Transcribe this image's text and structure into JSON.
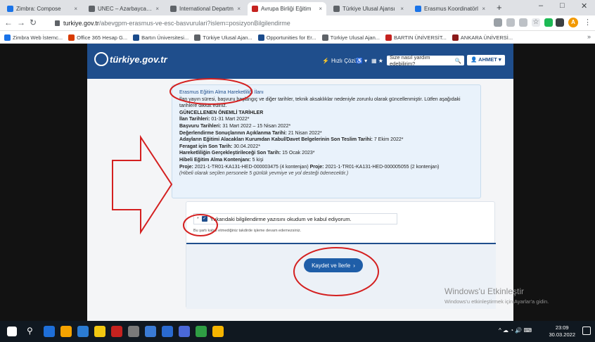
{
  "browser": {
    "tabs": [
      {
        "label": "Zimbra: Compose",
        "color": "#1a73e8"
      },
      {
        "label": "UNEC – Azarbaycan D",
        "color": "#5f6368"
      },
      {
        "label": "International Departm",
        "color": "#5f6368"
      },
      {
        "label": "Avrupa Birliği Eğitim",
        "color": "#c5221f",
        "active": true
      },
      {
        "label": "Türkiye Ulusal Ajansı",
        "color": "#5f6368"
      },
      {
        "label": "Erasmus Koordinatörl",
        "color": "#1a73e8"
      }
    ],
    "url_host": "turkiye.gov.tr",
    "url_path": "/abevgpm-erasmus-ve-esc-basvurulari?islem=posizyonBilgilendirme",
    "profile_initial": "A",
    "bookmarks": [
      {
        "label": "Zimbra Web İstemc...",
        "color": "#1a73e8"
      },
      {
        "label": "Office 365 Hesap G...",
        "color": "#d83b01"
      },
      {
        "label": "Bartın Üniversitesi...",
        "color": "#1a4b8c"
      },
      {
        "label": "Türkiye Ulusal Ajan...",
        "color": "#5f6368"
      },
      {
        "label": "Opportunities for Er...",
        "color": "#1a4b8c"
      },
      {
        "label": "Türkiye Ulusal Ajan...",
        "color": "#5f6368"
      },
      {
        "label": "BARTIN ÜNİVERSİT...",
        "color": "#c5221f"
      },
      {
        "label": "ANKARA ÜNİVERSİ...",
        "color": "#8b1a1a"
      }
    ]
  },
  "site": {
    "logo_text": "türkiye.gov.tr",
    "quick_ops": "Hızlı Çözüm",
    "search_placeholder": "Size nasıl yardım edebilirim?",
    "user_label": "AHMET"
  },
  "info_box": {
    "link_title": "Erasmus Eğitim Alma Hareketliliği İlanı",
    "intro": "İlan yayın süresi, başvuru başlangıç ve diğer tarihler, teknik aksaklıklar nedeniyle zorunlu olarak güncellenmiştir. Lütfen aşağıdaki tarihlere dikkat ediniz.",
    "updated_heading": "GÜNCELLENEN ÖNEMLİ TARİHLER",
    "lines": [
      {
        "label": "İlan Tarihleri:",
        "value": "01-31 Mart 2022*"
      },
      {
        "label": "Başvuru Tarihleri:",
        "value": "31 Mart 2022 – 15 Nisan 2022*"
      },
      {
        "label": "Değerlendirme Sonuçlarının Açıklanma Tarihi:",
        "value": "21 Nisan 2022*"
      },
      {
        "label": "Adayların Eğitimi Alacakları Kurumdan Kabul/Davet Belgelerinin Son Teslim Tarihi:",
        "value": "7 Ekim 2022*"
      },
      {
        "label": "Feragat için Son Tarih:",
        "value": "30.04.2022*"
      },
      {
        "label": "Hareketliliğin Gerçekleştirileceği Son Tarih:",
        "value": "15 Ocak 2023*"
      },
      {
        "label": "Hibeli Eğitim Alma Kontenjanı:",
        "value": "5 kişi"
      }
    ],
    "project_label": "Proje:",
    "project_1": "2021-1-TR01-KA131-HED-000003475 (4 kontenjan)",
    "project_2": "2021-1-TR01-KA131-HED-000005055 (2 kontenjan)",
    "footnote": "(Hibeli olarak seçilen personele 5 günlük yevmiye ve yol desteği ödenecektir.)"
  },
  "ack": {
    "checkbox_label": "Yukarıdaki bilgilendirme yazısını okudum ve kabul ediyorum.",
    "note": "Bu şartı kabul etmediğiniz takdirde işleme devam edemezsiniz.",
    "save_label": "Kaydet ve İlerle"
  },
  "watermark": {
    "line1": "Windows'u Etkinleştir",
    "line2": "Windows'u etkinleştirmek için Ayarlar'a gidin."
  },
  "taskbar": {
    "time": "23:09",
    "date": "30.03.2022"
  },
  "colors": {
    "header_blue": "#1f4e8c",
    "annotation_red": "#d42020",
    "button_blue": "#1f5ea8"
  }
}
